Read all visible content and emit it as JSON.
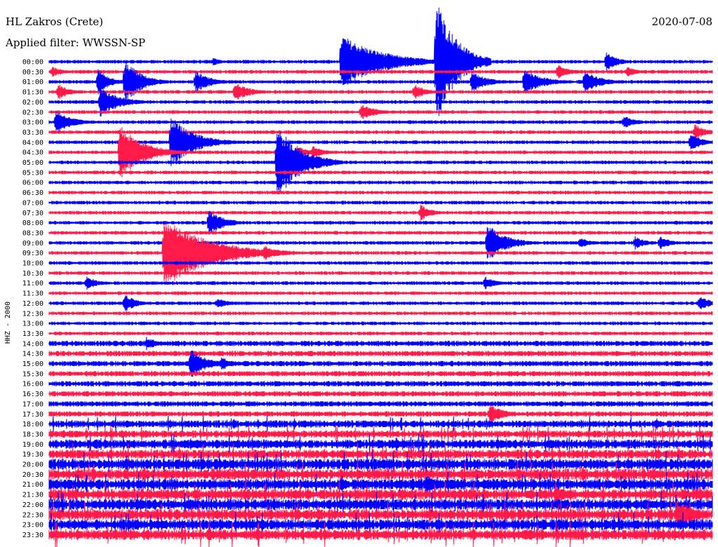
{
  "header": {
    "station": "HL Zakros (Crete)",
    "filter": "Applied filter: WWSSN-SP",
    "date": "2020-07-08",
    "channel": "HHZ - 2000"
  },
  "colors": {
    "a": "#0000ff",
    "b": "#ff1a4a",
    "background": "#ffffff"
  },
  "chart_data": {
    "type": "helicorder",
    "title": "HL Zakros (Crete)",
    "filter": "WWSSN-SP",
    "date": "2020-07-08",
    "ylabel": "HHZ - 2000",
    "rows": [
      "00:00",
      "00:30",
      "01:00",
      "01:30",
      "02:00",
      "02:30",
      "03:00",
      "03:30",
      "04:00",
      "04:30",
      "05:00",
      "05:30",
      "06:00",
      "06:30",
      "07:00",
      "07:30",
      "08:00",
      "08:30",
      "09:00",
      "09:30",
      "10:00",
      "10:30",
      "11:00",
      "11:30",
      "12:00",
      "12:30",
      "13:00",
      "13:30",
      "14:00",
      "14:30",
      "15:00",
      "15:30",
      "16:00",
      "16:30",
      "17:00",
      "17:30",
      "18:00",
      "18:30",
      "19:00",
      "19:30",
      "20:00",
      "20:30",
      "21:00",
      "21:30",
      "22:00",
      "22:30",
      "23:00",
      "23:30"
    ],
    "row_minutes": 30,
    "row_colors": [
      "a",
      "b"
    ],
    "noise_by_row": [
      2,
      2,
      2,
      2,
      2,
      2,
      2,
      2,
      2,
      2,
      2,
      2,
      2,
      2,
      2,
      2,
      2,
      2,
      2,
      2,
      2,
      2,
      2,
      2,
      2,
      2,
      2,
      2,
      3,
      3,
      3,
      3,
      3,
      3,
      3,
      3,
      4,
      4,
      5,
      5,
      6,
      6,
      6,
      6,
      6,
      6,
      6,
      6
    ],
    "events": [
      {
        "row": 0,
        "minute": 13.2,
        "amp": 40,
        "len": 5.0
      },
      {
        "row": 0,
        "minute": 17.5,
        "amp": 95,
        "len": 2.5
      },
      {
        "row": 0,
        "minute": 7.4,
        "amp": 6,
        "len": 1.2
      },
      {
        "row": 0,
        "minute": 25.2,
        "amp": 14,
        "len": 1.5
      },
      {
        "row": 1,
        "minute": 0.1,
        "amp": 8,
        "len": 1.5
      },
      {
        "row": 1,
        "minute": 23.0,
        "amp": 12,
        "len": 1.5
      },
      {
        "row": 1,
        "minute": 26.1,
        "amp": 8,
        "len": 1.5
      },
      {
        "row": 2,
        "minute": 2.2,
        "amp": 20,
        "len": 1.5
      },
      {
        "row": 2,
        "minute": 3.4,
        "amp": 36,
        "len": 2.0
      },
      {
        "row": 2,
        "minute": 6.6,
        "amp": 16,
        "len": 2.0
      },
      {
        "row": 2,
        "minute": 19.1,
        "amp": 16,
        "len": 2.0
      },
      {
        "row": 2,
        "minute": 21.5,
        "amp": 18,
        "len": 2.5
      },
      {
        "row": 2,
        "minute": 24.2,
        "amp": 18,
        "len": 2.0
      },
      {
        "row": 3,
        "minute": 0.4,
        "amp": 12,
        "len": 1.5
      },
      {
        "row": 3,
        "minute": 8.4,
        "amp": 14,
        "len": 2.0
      },
      {
        "row": 3,
        "minute": 16.5,
        "amp": 12,
        "len": 1.5
      },
      {
        "row": 4,
        "minute": 2.3,
        "amp": 22,
        "len": 2.5
      },
      {
        "row": 5,
        "minute": 14.1,
        "amp": 12,
        "len": 2.0
      },
      {
        "row": 6,
        "minute": 0.3,
        "amp": 18,
        "len": 2.0
      },
      {
        "row": 6,
        "minute": 26.0,
        "amp": 10,
        "len": 1.5
      },
      {
        "row": 7,
        "minute": 29.2,
        "amp": 12,
        "len": 1.5
      },
      {
        "row": 8,
        "minute": 5.5,
        "amp": 38,
        "len": 3.0
      },
      {
        "row": 8,
        "minute": 29.0,
        "amp": 14,
        "len": 1.5
      },
      {
        "row": 9,
        "minute": 3.2,
        "amp": 40,
        "len": 3.0
      },
      {
        "row": 9,
        "minute": 11.2,
        "amp": 10,
        "len": 1.5
      },
      {
        "row": 9,
        "minute": 11.9,
        "amp": 10,
        "len": 1.5
      },
      {
        "row": 10,
        "minute": 10.3,
        "amp": 55,
        "len": 3.0
      },
      {
        "row": 15,
        "minute": 16.8,
        "amp": 12,
        "len": 1.5
      },
      {
        "row": 16,
        "minute": 7.2,
        "amp": 20,
        "len": 2.0
      },
      {
        "row": 18,
        "minute": 19.8,
        "amp": 28,
        "len": 2.5
      },
      {
        "row": 18,
        "minute": 24.0,
        "amp": 8,
        "len": 1.5
      },
      {
        "row": 18,
        "minute": 26.5,
        "amp": 10,
        "len": 1.5
      },
      {
        "row": 18,
        "minute": 27.6,
        "amp": 10,
        "len": 1.5
      },
      {
        "row": 19,
        "minute": 9.7,
        "amp": 12,
        "len": 2.0
      },
      {
        "row": 19,
        "minute": 5.2,
        "amp": 50,
        "len": 6.0
      },
      {
        "row": 22,
        "minute": 1.7,
        "amp": 10,
        "len": 1.5
      },
      {
        "row": 22,
        "minute": 19.7,
        "amp": 10,
        "len": 1.5
      },
      {
        "row": 24,
        "minute": 3.4,
        "amp": 14,
        "len": 1.5
      },
      {
        "row": 24,
        "minute": 7.6,
        "amp": 8,
        "len": 1.5
      },
      {
        "row": 24,
        "minute": 29.4,
        "amp": 12,
        "len": 1.5
      },
      {
        "row": 28,
        "minute": 4.4,
        "amp": 10,
        "len": 1.5
      },
      {
        "row": 30,
        "minute": 6.4,
        "amp": 22,
        "len": 2.0
      },
      {
        "row": 30,
        "minute": 7.8,
        "amp": 10,
        "len": 1.5
      },
      {
        "row": 35,
        "minute": 19.9,
        "amp": 14,
        "len": 2.0
      },
      {
        "row": 42,
        "minute": 17.0,
        "amp": 14,
        "len": 2.0
      },
      {
        "row": 43,
        "minute": 22.9,
        "amp": 12,
        "len": 2.0
      },
      {
        "row": 45,
        "minute": 28.4,
        "amp": 20,
        "len": 3.0
      }
    ]
  }
}
